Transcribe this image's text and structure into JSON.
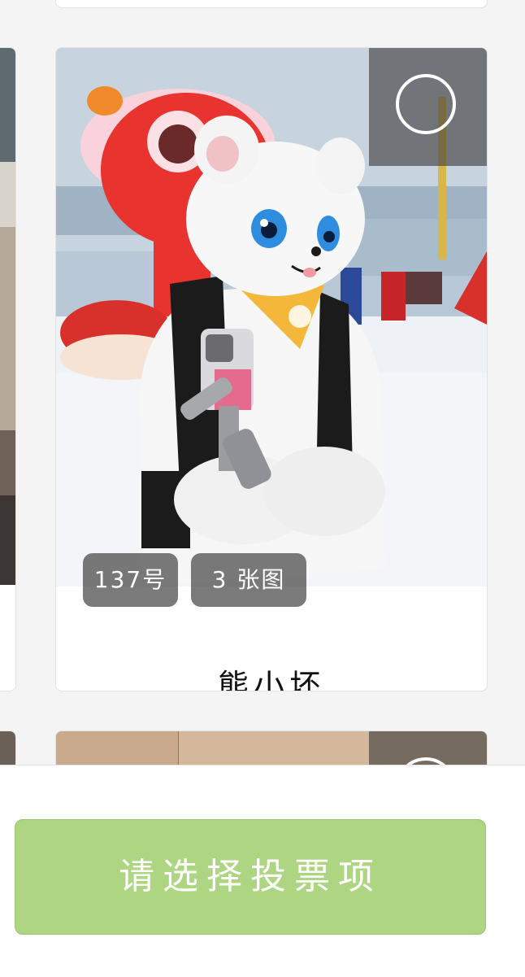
{
  "entry": {
    "number_badge": "137号",
    "image_count_badge": "3 张图",
    "name": "熊小坏",
    "photo_alt": "White fluffy fursuit character wearing a yellow paw-print bandana and black vest, holding a phone gimbal in a snowy indoor park"
  },
  "vote_button": {
    "label": "请选择投票项"
  },
  "colors": {
    "vote_button_bg": "#aed581",
    "overlay": "#3c3c3c"
  }
}
